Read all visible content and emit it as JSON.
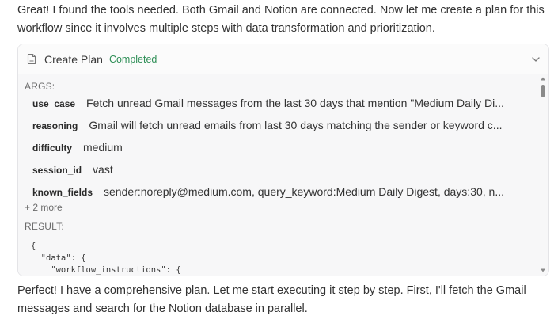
{
  "messages": {
    "intro": "Great! I found the tools needed. Both Gmail and Notion are connected. Now let me create a plan for this workflow since it involves multiple steps with data transformation and prioritization.",
    "followup": "Perfect! I have a comprehensive plan. Let me start executing it step by step. First, I'll fetch the Gmail messages and search for the Notion database in parallel."
  },
  "tool_call": {
    "icon": "document-icon",
    "title": "Create Plan",
    "status": "Completed",
    "status_color": "#2f8f57",
    "args_label": "ARGS:",
    "args": [
      {
        "key": "use_case",
        "value": "Fetch unread Gmail messages from the last 30 days that mention \"Medium Daily Di..."
      },
      {
        "key": "reasoning",
        "value": "Gmail will fetch unread emails from last 30 days matching the sender or keyword c..."
      },
      {
        "key": "difficulty",
        "value": "medium"
      },
      {
        "key": "session_id",
        "value": "vast"
      },
      {
        "key": "known_fields",
        "value": "sender:noreply@medium.com, query_keyword:Medium Daily Digest, days:30, n..."
      }
    ],
    "more_label": "+ 2 more",
    "result_label": "RESULT:",
    "result_code": "{\n  \"data\": {\n    \"workflow_instructions\": {"
  }
}
